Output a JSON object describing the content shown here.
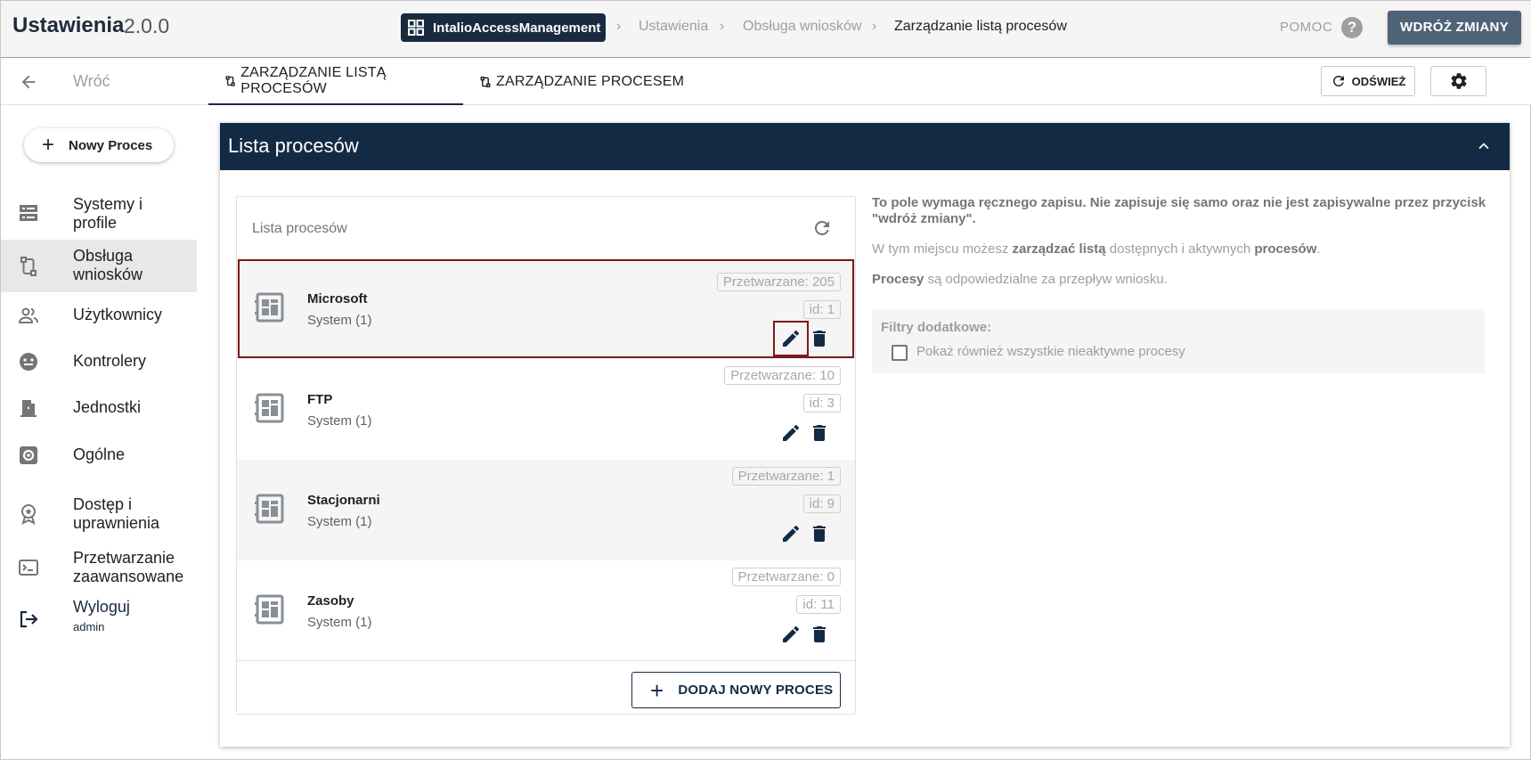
{
  "header": {
    "app_title": "Ustawienia",
    "app_version": "2.0.0",
    "breadcrumb_app": "IntalioAccessManagement",
    "breadcrumbs": [
      "Ustawienia",
      "Obsługa wniosków",
      "Zarządzanie listą procesów"
    ],
    "help_label": "POMOC",
    "help_icon_glyph": "?",
    "deploy_label": "WDRÓŻ ZMIANY"
  },
  "subbar": {
    "back_label": "Wróć",
    "tabs": [
      {
        "label": "ZARZĄDZANIE LISTĄ PROCESÓW",
        "active": true
      },
      {
        "label": "ZARZĄDZANIE PROCESEM",
        "active": false
      }
    ],
    "refresh_label": "ODŚWIEŻ"
  },
  "sidebar": {
    "new_process_label": "Nowy Proces",
    "items": [
      {
        "label": "Systemy i profile",
        "icon": "server-icon"
      },
      {
        "label": "Obsługa wniosków",
        "icon": "process-flow-icon",
        "active": true
      },
      {
        "label": "Użytkownicy",
        "icon": "users-icon"
      },
      {
        "label": "Kontrolery",
        "icon": "controller-icon"
      },
      {
        "label": "Jednostki",
        "icon": "door-icon"
      },
      {
        "label": "Ogólne",
        "icon": "settings-box-icon"
      },
      {
        "label": "Dostęp i uprawnienia",
        "icon": "badge-icon"
      },
      {
        "label": "Przetwarzanie zaawansowane",
        "icon": "terminal-icon"
      },
      {
        "label": "Wyloguj",
        "sub": "admin",
        "icon": "logout-icon"
      }
    ]
  },
  "main": {
    "card_title": "Lista procesów",
    "list_title": "Lista procesów",
    "processes": [
      {
        "name": "Microsoft",
        "system": "System (1)",
        "processing": "Przetwarzane: 205",
        "id": "id: 1",
        "selected": true
      },
      {
        "name": "FTP",
        "system": "System (1)",
        "processing": "Przetwarzane: 10",
        "id": "id: 3"
      },
      {
        "name": "Stacjonarni",
        "system": "System (1)",
        "processing": "Przetwarzane: 1",
        "id": "id: 9"
      },
      {
        "name": "Zasoby",
        "system": "System (1)",
        "processing": "Przetwarzane: 0",
        "id": "id: 11"
      }
    ],
    "add_process_label": "DODAJ NOWY PROCES",
    "info": {
      "manual_save_note": "To pole wymaga ręcznego zapisu. Nie zapisuje się samo oraz nie jest zapisywalne przez przycisk \"wdróż zmiany\".",
      "line2_a": "W tym miejscu możesz ",
      "line2_b": "zarządzać listą",
      "line2_c": " dostępnych i aktywnych ",
      "line2_d": "procesów",
      "line2_e": ".",
      "line3_a": "Procesy",
      "line3_b": " są odpowiedzialne za przepływ wniosku."
    },
    "filters": {
      "title": "Filtry dodatkowe:",
      "show_inactive_label": "Pokaż również wszystkie nieaktywne procesy",
      "show_inactive_checked": false
    }
  },
  "colors": {
    "navy": "#132a45",
    "deploy_button": "#4f6377",
    "selection_outline": "#7b1a1a"
  }
}
